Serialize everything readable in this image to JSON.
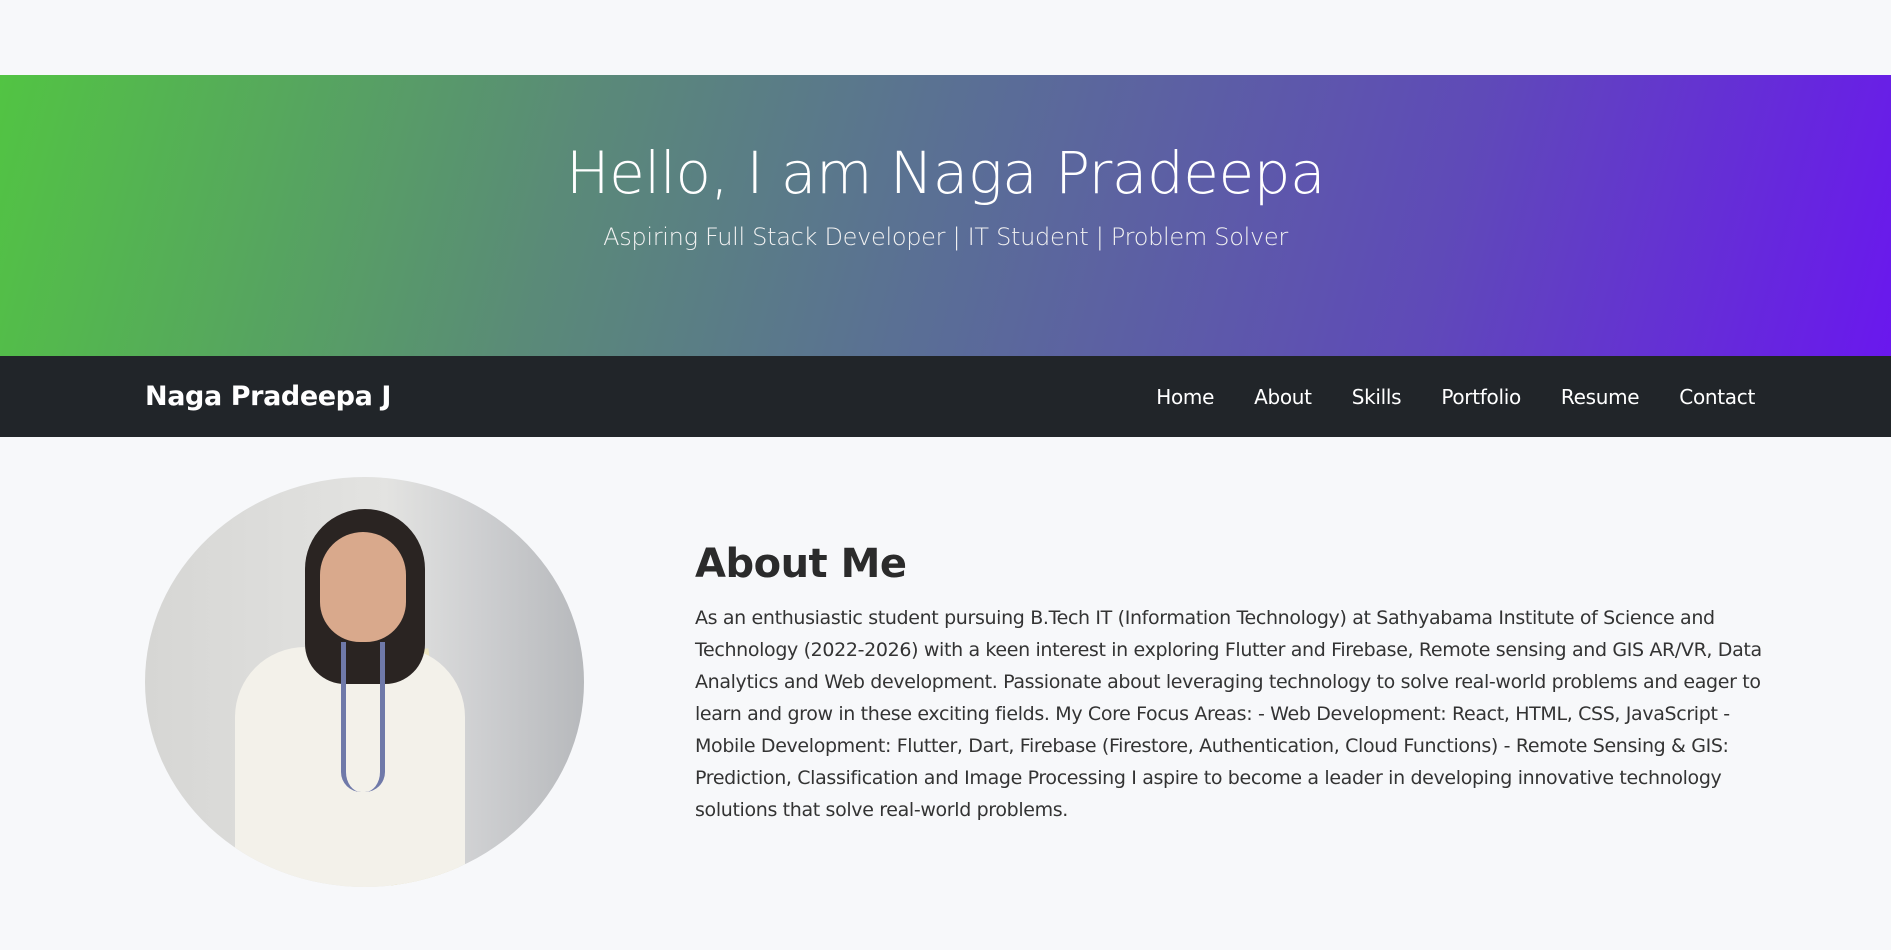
{
  "hero": {
    "title": "Hello, I am Naga Pradeepa",
    "subtitle": "Aspiring Full Stack Developer | IT Student | Problem Solver"
  },
  "navbar": {
    "brand": "Naga Pradeepa J",
    "links": [
      "Home",
      "About",
      "Skills",
      "Portfolio",
      "Resume",
      "Contact"
    ]
  },
  "about": {
    "heading": "About Me",
    "body": "As an enthusiastic student pursuing B.Tech IT (Information Technology) at Sathyabama Institute of Science and Technology (2022-2026) with a keen interest in exploring Flutter and Firebase, Remote sensing and GIS AR/VR, Data Analytics and Web development. Passionate about leveraging technology to solve real-world problems and eager to learn and grow in these exciting fields. My Core Focus Areas: - Web Development: React, HTML, CSS, JavaScript - Mobile Development: Flutter, Dart, Firebase (Firestore, Authentication, Cloud Functions) - Remote Sensing & GIS: Prediction, Classification and Image Processing I aspire to become a leader in developing innovative technology solutions that solve real-world problems."
  },
  "colors": {
    "gradient_start": "#52c443",
    "gradient_end": "#6a16f0",
    "navbar_bg": "#212529",
    "page_bg": "#f7f8fa"
  }
}
